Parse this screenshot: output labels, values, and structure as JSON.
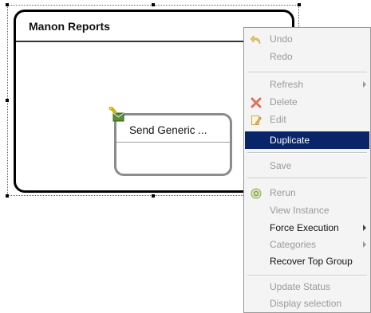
{
  "diagram": {
    "group_title": "Manon Reports",
    "task_title": "Send Generic ..."
  },
  "context_menu": {
    "items": [
      {
        "label": "Undo",
        "icon": "undo-icon",
        "enabled": false
      },
      {
        "label": "Redo",
        "enabled": false
      },
      {
        "label": "Refresh",
        "enabled": false,
        "submenu": true
      },
      {
        "label": "Delete",
        "icon": "delete-icon",
        "enabled": false
      },
      {
        "label": "Edit",
        "icon": "edit-icon",
        "enabled": false
      },
      {
        "label": "Duplicate",
        "enabled": true,
        "selected": true
      },
      {
        "label": "Save",
        "enabled": false
      },
      {
        "label": "Rerun",
        "icon": "rerun-icon",
        "enabled": false
      },
      {
        "label": "View Instance",
        "enabled": false
      },
      {
        "label": "Force Execution",
        "enabled": true,
        "submenu": true
      },
      {
        "label": "Categories",
        "enabled": false,
        "submenu": true
      },
      {
        "label": "Recover Top Group",
        "enabled": true
      },
      {
        "label": "Update Status",
        "enabled": false
      },
      {
        "label": "Display selection",
        "enabled": false
      }
    ]
  },
  "colors": {
    "selection": "#0a246a",
    "disabled_text": "#9a9a9a",
    "menu_bg": "#f4f4f4"
  }
}
